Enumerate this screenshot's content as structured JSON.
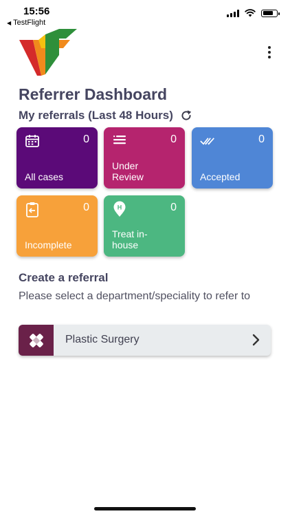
{
  "status_bar": {
    "time": "15:56",
    "back_app": "TestFlight"
  },
  "header": {
    "title": "Referrer Dashboard",
    "subtitle": "My referrals (Last 48 Hours)"
  },
  "cards": [
    {
      "label": "All cases",
      "count": "0",
      "icon": "calendar-icon",
      "color": "#5b0a78"
    },
    {
      "label": "Under Review",
      "count": "0",
      "icon": "list-icon",
      "color": "#b5246e"
    },
    {
      "label": "Accepted",
      "count": "0",
      "icon": "double-check-icon",
      "color": "#4f86d6"
    },
    {
      "label": "Incomplete",
      "count": "0",
      "icon": "clipboard-icon",
      "color": "#f7a13a"
    },
    {
      "label": "Treat in-house",
      "count": "0",
      "icon": "hospital-pin-icon",
      "color": "#4cb781"
    }
  ],
  "create": {
    "title": "Create a referral",
    "instructions": "Please select a department/speciality to refer to",
    "department": {
      "label": "Plastic Surgery",
      "icon": "bandage-icon",
      "color": "#6a2149"
    }
  }
}
